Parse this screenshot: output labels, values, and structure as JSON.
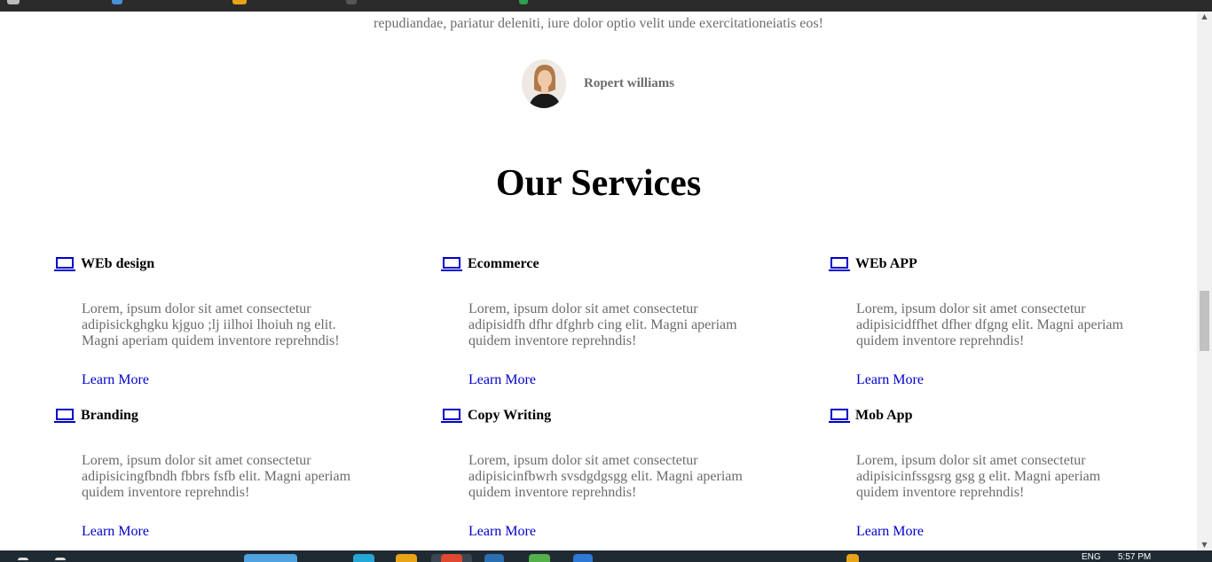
{
  "testimonial": {
    "text_cut": "",
    "text_last": "repudiandae, pariatur deleniti, iure dolor optio velit unde exercitationeiatis eos!",
    "author_name": "Ropert williams"
  },
  "services": {
    "title": "Our Services",
    "items": [
      {
        "title": "WEb design",
        "desc": "Lorem, ipsum dolor sit amet consectetur adipisickghgku kjguo ;lj iilhoi lhoiuh ng elit. Magni aperiam quidem inventore reprehndis!",
        "link": "Learn More"
      },
      {
        "title": "Ecommerce",
        "desc": "Lorem, ipsum dolor sit amet consectetur adipisidfh dfhr dfghrb cing elit. Magni aperiam quidem inventore reprehndis!",
        "link": "Learn More"
      },
      {
        "title": "WEb APP",
        "desc": "Lorem, ipsum dolor sit amet consectetur adipisicidffhet dfher dfgng elit. Magni aperiam quidem inventore reprehndis!",
        "link": "Learn More"
      },
      {
        "title": "Branding",
        "desc": "Lorem, ipsum dolor sit amet consectetur adipisicingfbndh fbbrs fsfb elit. Magni aperiam quidem inventore reprehndis!",
        "link": "Learn More"
      },
      {
        "title": "Copy Writing",
        "desc": "Lorem, ipsum dolor sit amet consectetur adipisicinfbwrh svsdgdgsgg elit. Magni aperiam quidem inventore reprehndis!",
        "link": "Learn More"
      },
      {
        "title": "Mob App",
        "desc": "Lorem, ipsum dolor sit amet consectetur adipisicinfssgsrg gsg g elit. Magni aperiam quidem inventore reprehndis!",
        "link": "Learn More"
      }
    ]
  },
  "taskbar": {
    "language": "ENG",
    "time": "5:57 PM"
  },
  "colors": {
    "link": "#0000cc",
    "icon": "#0000cc",
    "muted_text": "#6b6b6b"
  },
  "icons": {
    "service_icon": "laptop-icon"
  }
}
